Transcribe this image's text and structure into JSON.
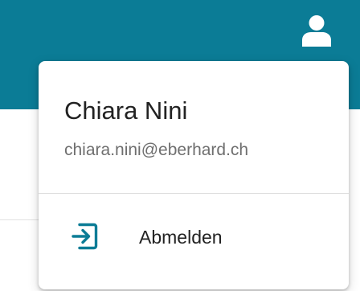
{
  "colors": {
    "header": "#0b7c96",
    "accent": "#0b7c96",
    "text_primary": "#222222",
    "text_secondary": "#6f6f6f",
    "icon_light": "#ffffff"
  },
  "header": {
    "user_icon": "user-icon"
  },
  "user_menu": {
    "name": "Chiara Nini",
    "email": "chiara.nini@eberhard.ch",
    "items": [
      {
        "label": "Abmelden",
        "icon": "logout-icon"
      }
    ]
  }
}
